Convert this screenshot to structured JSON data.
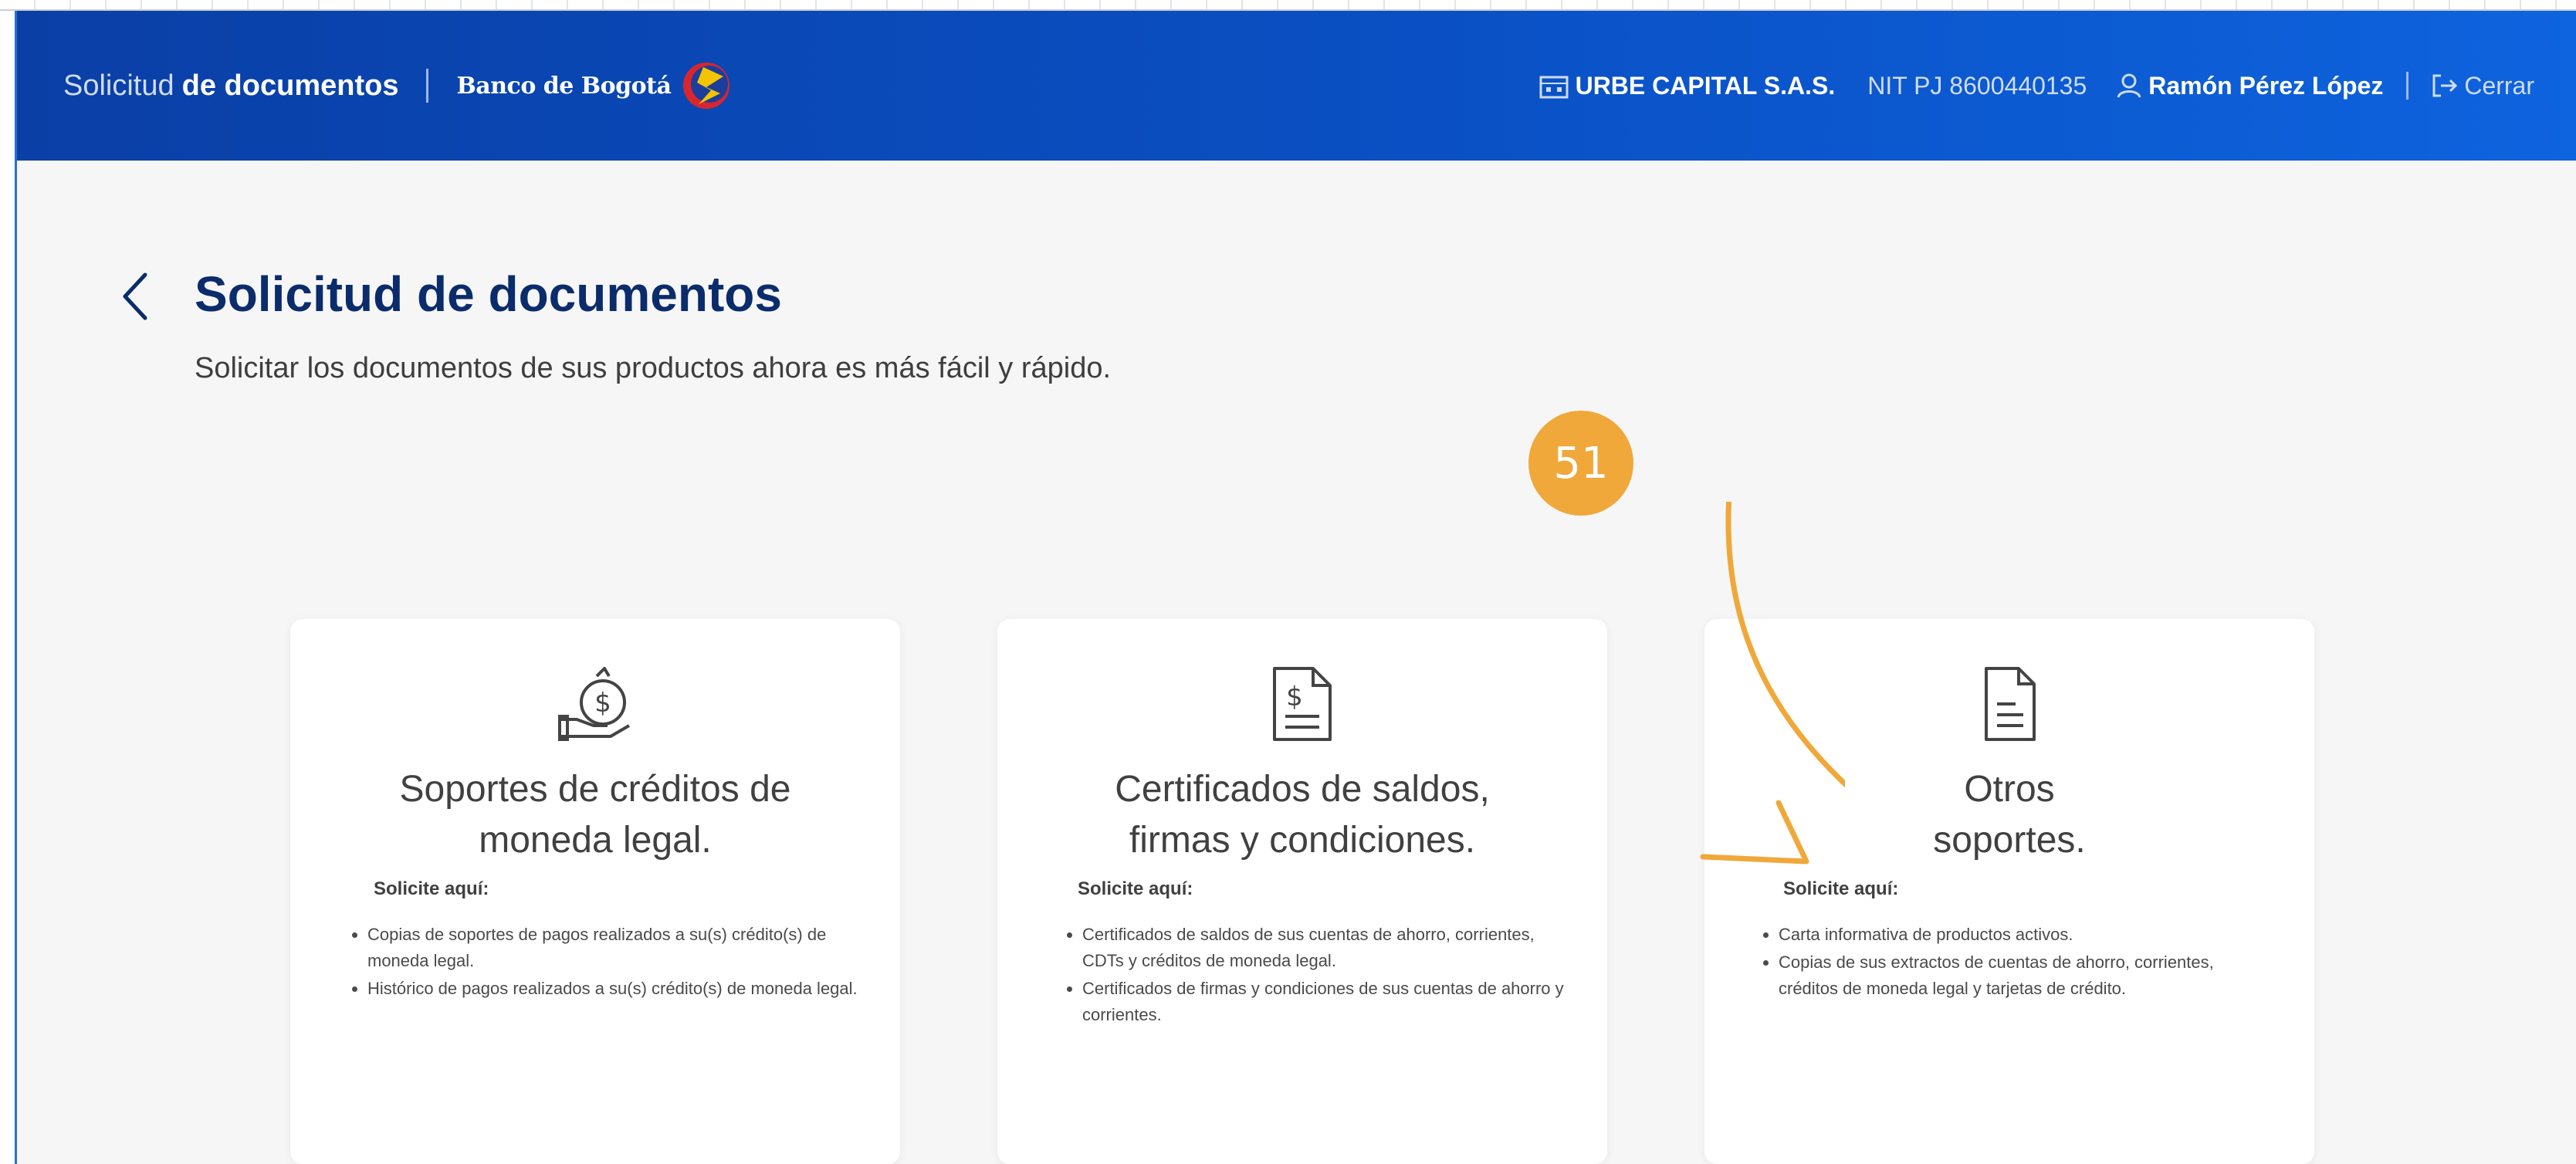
{
  "header": {
    "app_title_light": "Solicitud",
    "app_title_bold": "de documentos",
    "bank_name": "Banco de Bogotá",
    "company": "URBE CAPITAL S.A.S.",
    "nit": "NIT PJ 8600440135",
    "user": "Ramón Pérez López",
    "logout": "Cerrar"
  },
  "page": {
    "title": "Solicitud de documentos",
    "subtitle": "Solicitar los documentos de sus productos ahora es más fácil y rápido."
  },
  "cards": [
    {
      "title_line1": "Soportes de créditos de",
      "title_line2": "moneda legal.",
      "solicite": "Solicite aquí:",
      "items": [
        "Copias de soportes de pagos realizados a su(s) crédito(s) de moneda legal.",
        "Histórico de pagos realizados a su(s) crédito(s) de moneda legal."
      ],
      "icon": "money-bag-hand-icon"
    },
    {
      "title_line1": "Certificados de saldos,",
      "title_line2": "firmas y condiciones.",
      "solicite": "Solicite aquí:",
      "items": [
        "Certificados de saldos de sus cuentas de ahorro, corrientes, CDTs y créditos de moneda legal.",
        "Certificados de firmas y condiciones de sus cuentas de ahorro y corrientes."
      ],
      "icon": "dollar-document-icon"
    },
    {
      "title_line1": "Otros",
      "title_line2": "soportes.",
      "solicite": "Solicite aquí:",
      "items": [
        "Carta informativa de productos activos.",
        "Copias de sus extractos de cuentas de ahorro, corrientes, créditos de moneda legal y tarjetas de crédito."
      ],
      "icon": "document-icon"
    }
  ],
  "annotation": {
    "badge_number": "51",
    "color": "#f0a83a"
  },
  "colors": {
    "header_start": "#0a3fa6",
    "header_end": "#0e63de",
    "title": "#0b2c6b",
    "background": "#f6f6f6"
  }
}
